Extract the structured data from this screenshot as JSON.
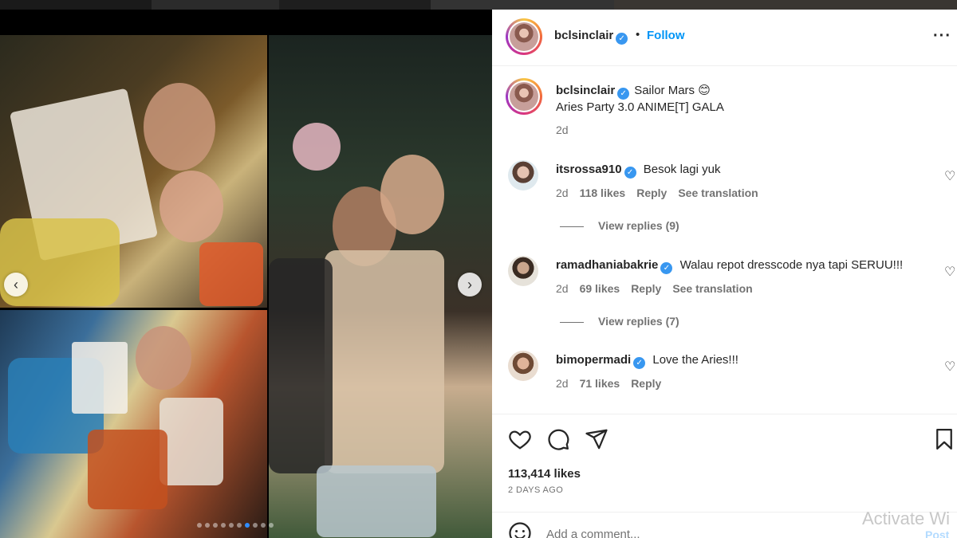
{
  "post": {
    "username": "bclsinclair",
    "follow_label": "Follow",
    "separator": "•",
    "more_icon": "more-options-icon"
  },
  "caption": {
    "username": "bclsinclair",
    "text_line1": "Sailor Mars 😊",
    "text_line2": "Aries Party 3.0 ANIME[T] GALA",
    "time": "2d"
  },
  "comments": [
    {
      "username": "itsrossa910",
      "text": "Besok lagi yuk",
      "time": "2d",
      "likes": "118 likes",
      "reply_label": "Reply",
      "translation_label": "See translation",
      "view_replies": "View replies (9)"
    },
    {
      "username": "ramadhaniabakrie",
      "text": "Walau repot dresscode nya tapi SERUU!!!",
      "time": "2d",
      "likes": "69 likes",
      "reply_label": "Reply",
      "translation_label": "See translation",
      "view_replies": "View replies (7)"
    },
    {
      "username": "bimopermadi",
      "text": "Love the Aries!!!",
      "time": "2d",
      "likes": "71 likes",
      "reply_label": "Reply"
    }
  ],
  "stats": {
    "likes": "113,414 likes",
    "date": "2 DAYS AGO"
  },
  "add_comment": {
    "placeholder": "Add a comment...",
    "post_label": "Post"
  },
  "carousel": {
    "slide_count": 10,
    "active_index": 6
  },
  "watermark": "Activate Wi",
  "colors": {
    "accent": "#0095f6",
    "verified": "#3897f0",
    "muted": "#737373"
  }
}
